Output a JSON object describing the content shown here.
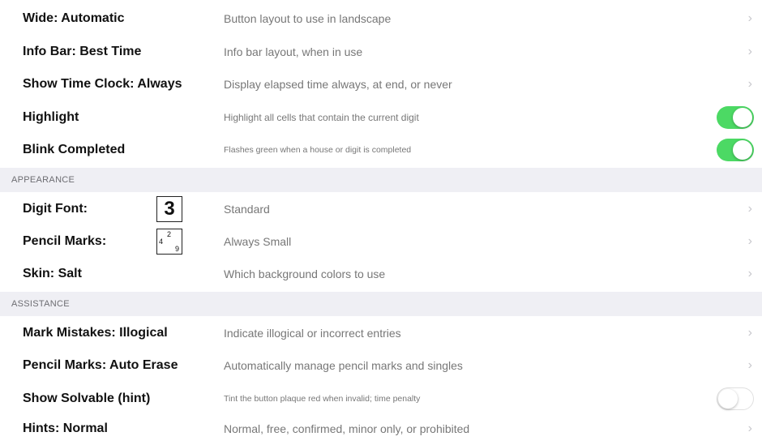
{
  "rows_top": [
    {
      "label": "Wide: Automatic",
      "desc": "Button layout to use in landscape",
      "control": "chevron"
    },
    {
      "label": "Info Bar: Best Time",
      "desc": "Info bar layout, when in use",
      "control": "chevron"
    },
    {
      "label": "Show Time Clock: Always",
      "desc": "Display elapsed time always, at end, or never",
      "control": "chevron"
    },
    {
      "label": "Highlight",
      "desc": "Highlight all cells that contain the current digit",
      "control": "toggle-on"
    },
    {
      "label": "Blink Completed",
      "desc": "Flashes green when a house or digit is completed",
      "control": "toggle-on"
    }
  ],
  "appearance": {
    "header": "APPEARANCE",
    "rows": [
      {
        "label": "Digit Font:",
        "sample": "3",
        "desc": "Standard",
        "control": "chevron"
      },
      {
        "label": "Pencil Marks:",
        "sample_marks": [
          "4",
          "2",
          "9"
        ],
        "desc": "Always Small",
        "control": "chevron"
      },
      {
        "label": "Skin: Salt",
        "desc": "Which background colors to use",
        "control": "chevron"
      }
    ]
  },
  "assistance": {
    "header": "ASSISTANCE",
    "rows": [
      {
        "label": "Mark Mistakes: Illogical",
        "desc": "Indicate illogical or incorrect entries",
        "control": "chevron"
      },
      {
        "label": "Pencil Marks: Auto Erase",
        "desc": "Automatically manage pencil marks and singles",
        "control": "chevron"
      },
      {
        "label": "Show Solvable (hint)",
        "desc": "Tint the button plaque red when invalid; time penalty",
        "control": "toggle-off"
      },
      {
        "label": "Hints: Normal",
        "desc": "Normal, free, confirmed, minor only, or prohibited",
        "control": "chevron"
      }
    ]
  },
  "icons": {
    "chevron": "›"
  },
  "colors": {
    "toggle_on": "#4cd964",
    "section_bg": "#efeff4",
    "chevron": "#c7c7cc"
  }
}
